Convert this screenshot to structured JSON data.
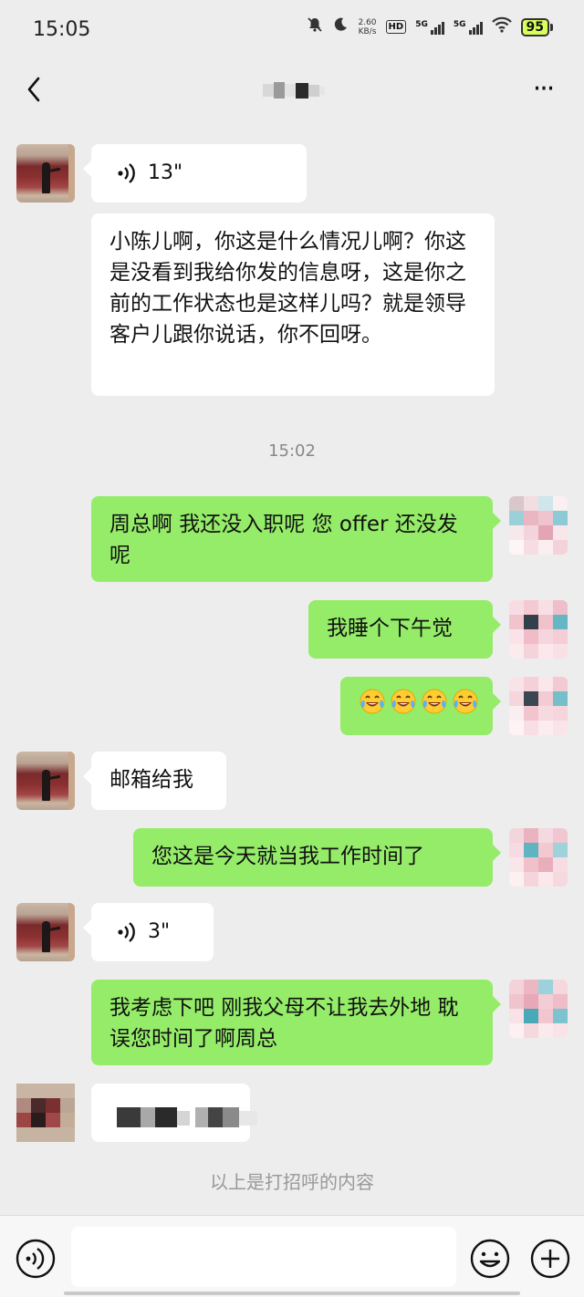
{
  "status_bar": {
    "time": "15:05",
    "net_speed_value": "2.60",
    "net_speed_unit": "KB/s",
    "hd_label": "HD",
    "signal_1": "5G",
    "signal_2": "5G",
    "battery": "95"
  },
  "nav": {
    "back_icon": "chevron-left-icon",
    "more_icon": "more-horizontal-icon",
    "more_label": "···"
  },
  "colors": {
    "background": "#ededed",
    "incoming_bubble": "#ffffff",
    "outgoing_bubble": "#95ec69",
    "timestamp_text": "#888888"
  },
  "messages": [
    {
      "direction": "in",
      "type": "voice",
      "duration": "13\""
    },
    {
      "direction": "in",
      "type": "text",
      "text": "小陈儿啊，你这是什么情况儿啊？你这是没看到我给你发的信息呀，这是你之前的工作状态也是这样儿吗？就是领导客户儿跟你说话，你不回呀。"
    },
    {
      "type": "timestamp",
      "text": "15:02"
    },
    {
      "direction": "out",
      "type": "text",
      "text": "周总啊  我还没入职呢  您 offer 还没发呢"
    },
    {
      "direction": "out",
      "type": "text",
      "text": "我睡个下午觉"
    },
    {
      "direction": "out",
      "type": "emoji",
      "emoji": [
        "😂",
        "😂",
        "😂",
        "😂"
      ]
    },
    {
      "direction": "in",
      "type": "text",
      "text": "邮箱给我"
    },
    {
      "direction": "out",
      "type": "text",
      "text": "您这是今天就当我工作时间了"
    },
    {
      "direction": "in",
      "type": "voice",
      "duration": "3\""
    },
    {
      "direction": "out",
      "type": "text",
      "text": "我考虑下吧  刚我父母不让我去外地  耽误您时间了啊周总"
    }
  ],
  "system_note": "以上是打招呼的内容",
  "input_bar": {
    "voice_icon": "voice-input-icon",
    "emoji_icon": "smiley-icon",
    "plus_icon": "plus-circle-icon",
    "placeholder": ""
  }
}
